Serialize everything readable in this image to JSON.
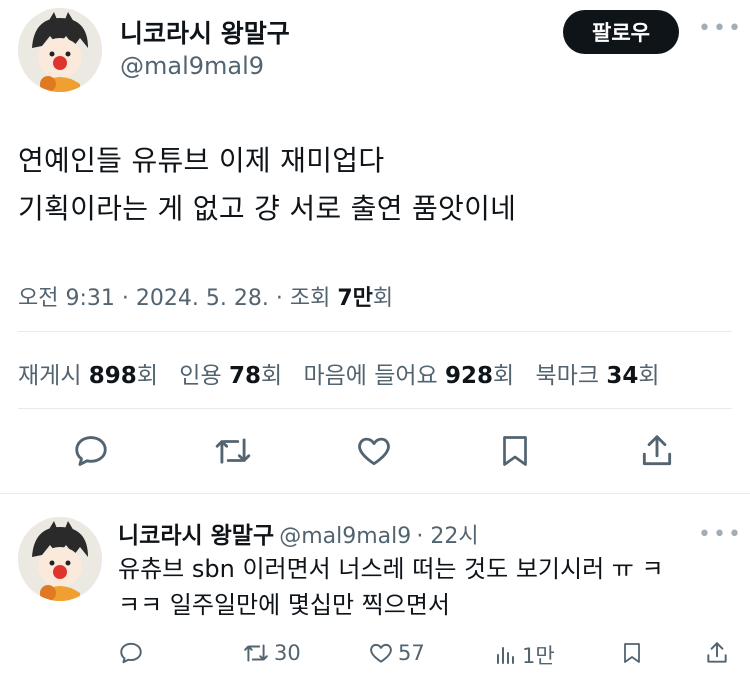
{
  "tweet": {
    "author_name": "니코라시 왕말구",
    "author_handle": "@mal9mal9",
    "follow_label": "팔로우",
    "lines": [
      "연예인들 유튜브 이제 재미업다",
      "기획이라는 게 없고 걍 서로 출연 품앗이네"
    ],
    "time": "오전 9:31",
    "date": "2024. 5. 28.",
    "views_label": "조회",
    "views_count": "7만",
    "views_suffix": "회",
    "stats": {
      "retweets_label": "재게시",
      "retweets": "898",
      "quotes_label": "인용",
      "quotes": "78",
      "likes_label": "마음에 들어요",
      "likes": "928",
      "bookmarks_label": "북마크",
      "bookmarks": "34",
      "unit": "회"
    }
  },
  "reply": {
    "author_name": "니코라시 왕말구",
    "author_handle": "@mal9mal9",
    "time": "22시",
    "lines": [
      "유츄브 sbn 이러면서 너스레 떠는 것도 보기시러 ㅠ ㅋ",
      "ㅋㅋ 일주일만에 몇십만 찍으면서"
    ],
    "retweets": "30",
    "likes": "57",
    "views": "1만"
  },
  "icons": [
    "more-icon",
    "reply-icon",
    "retweet-icon",
    "like-icon",
    "bookmark-icon",
    "share-icon",
    "views-icon"
  ]
}
